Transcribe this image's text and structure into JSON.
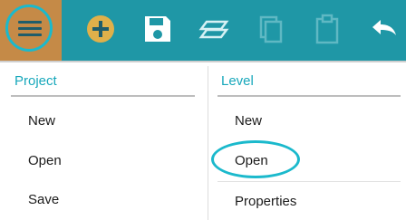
{
  "toolbar": {
    "menu_icon": "hamburger-icon",
    "buttons": [
      {
        "name": "add",
        "icon": "plus-circle-icon",
        "color": "#e0b04a"
      },
      {
        "name": "save",
        "icon": "floppy-disk-icon",
        "color": "#ffffff"
      },
      {
        "name": "layers",
        "icon": "layers-icon",
        "color": "#cfeff3"
      },
      {
        "name": "copy",
        "icon": "copy-icon",
        "color": "#5fb8c3"
      },
      {
        "name": "paste",
        "icon": "clipboard-icon",
        "color": "#5fb8c3"
      },
      {
        "name": "undo",
        "icon": "undo-icon",
        "color": "#ffffff"
      }
    ]
  },
  "menu": {
    "project": {
      "title": "Project",
      "items": [
        "New",
        "Open",
        "Save"
      ]
    },
    "level": {
      "title": "Level",
      "items": [
        "New",
        "Open",
        "Properties"
      ]
    }
  },
  "colors": {
    "toolbar_bg": "#1f97a6",
    "menu_button_bg": "#c58a47",
    "accent": "#18a8bb",
    "highlight_ring": "#1bb9cc"
  }
}
